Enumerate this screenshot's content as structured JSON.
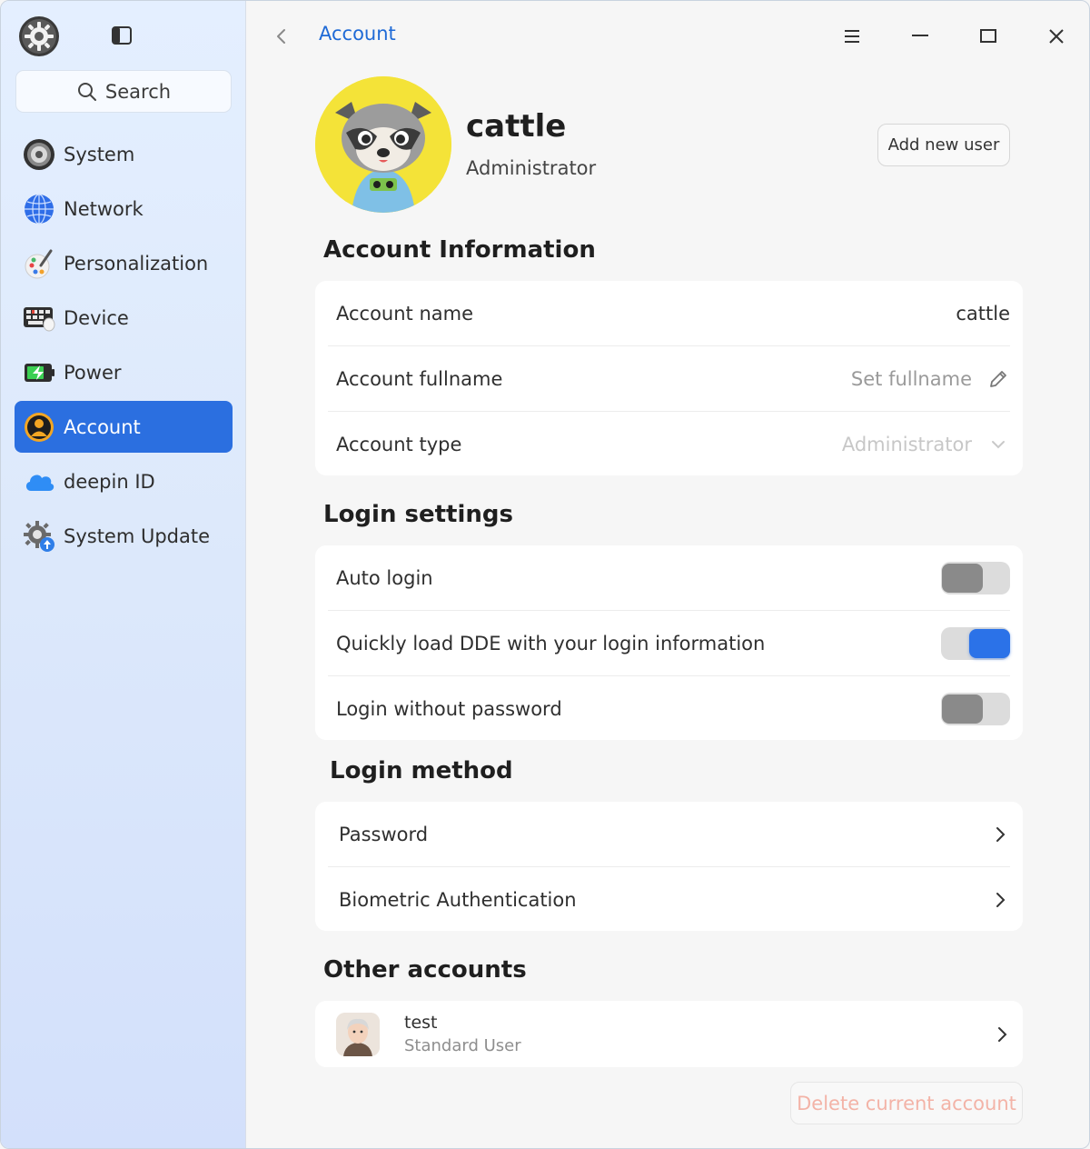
{
  "sidebar": {
    "search_label": "Search",
    "items": [
      {
        "label": "System",
        "icon": "system-icon"
      },
      {
        "label": "Network",
        "icon": "network-globe-icon"
      },
      {
        "label": "Personalization",
        "icon": "palette-brush-icon"
      },
      {
        "label": "Device",
        "icon": "keyboard-device-icon"
      },
      {
        "label": "Power",
        "icon": "battery-power-icon"
      },
      {
        "label": "Account",
        "icon": "account-icon",
        "active": true
      },
      {
        "label": "deepin ID",
        "icon": "cloud-icon"
      },
      {
        "label": "System Update",
        "icon": "gear-update-icon"
      }
    ]
  },
  "header": {
    "breadcrumb": "Account"
  },
  "profile": {
    "name": "cattle",
    "role": "Administrator",
    "add_user_label": "Add new user"
  },
  "account_info": {
    "title": "Account Information",
    "name_label": "Account name",
    "name_value": "cattle",
    "fullname_label": "Account fullname",
    "fullname_placeholder": "Set fullname",
    "type_label": "Account type",
    "type_value": "Administrator"
  },
  "login_settings": {
    "title": "Login settings",
    "auto_login_label": "Auto login",
    "auto_login_on": false,
    "quick_load_label": "Quickly load DDE with your login information",
    "quick_load_on": true,
    "no_password_label": "Login without password",
    "no_password_on": false
  },
  "login_method": {
    "title": "Login method",
    "password_label": "Password",
    "biometric_label": "Biometric Authentication"
  },
  "other_accounts": {
    "title": "Other accounts",
    "users": [
      {
        "name": "test",
        "role": "Standard User"
      }
    ]
  },
  "delete_label": "Delete current account",
  "colors": {
    "accent": "#2b6fe0",
    "link": "#1f6ad6",
    "danger_muted": "#f3b3a7"
  }
}
